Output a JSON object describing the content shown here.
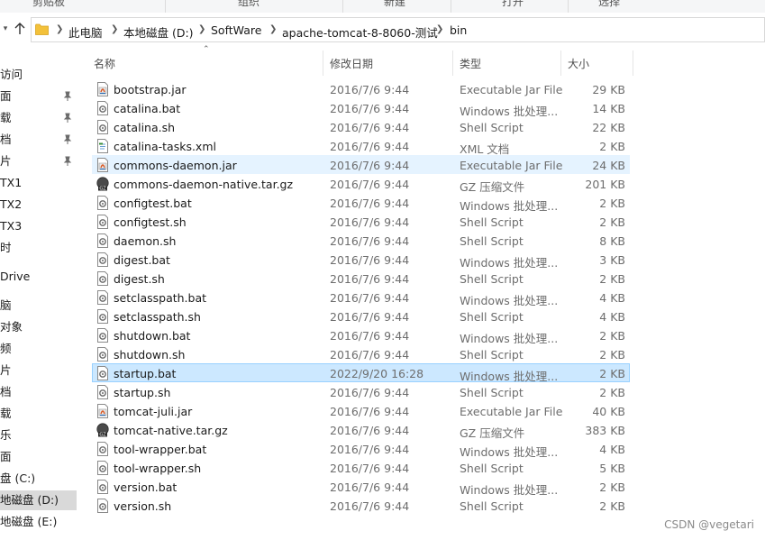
{
  "ribbon": {
    "groups": [
      "剪贴板",
      "组织",
      "新建",
      "打开",
      "选择"
    ]
  },
  "nav": {
    "back_icon": "arrow-left-icon",
    "forward_icon": "arrow-right-icon",
    "recent_icon": "chevron-down-icon",
    "up_icon": "arrow-up-icon"
  },
  "address": {
    "folder_icon": "folder-icon",
    "crumbs": [
      "此电脑",
      "本地磁盘 (D:)",
      "SoftWare",
      "apache-tomcat-8-8060-测试",
      "bin"
    ]
  },
  "navpane": {
    "items": [
      {
        "label": "访问",
        "pinned": false
      },
      {
        "label": "面",
        "pinned": true
      },
      {
        "label": "载",
        "pinned": true
      },
      {
        "label": "档",
        "pinned": true
      },
      {
        "label": "片",
        "pinned": true
      },
      {
        "label": "TX1",
        "pinned": false
      },
      {
        "label": "TX2",
        "pinned": false
      },
      {
        "label": "TX3",
        "pinned": false
      },
      {
        "label": "时",
        "pinned": false
      },
      {
        "label": "Drive",
        "pinned": false
      },
      {
        "label": "脑",
        "pinned": false
      },
      {
        "label": "对象",
        "pinned": false
      },
      {
        "label": "频",
        "pinned": false
      },
      {
        "label": "片",
        "pinned": false
      },
      {
        "label": "档",
        "pinned": false
      },
      {
        "label": "载",
        "pinned": false
      },
      {
        "label": "乐",
        "pinned": false
      },
      {
        "label": "面",
        "pinned": false
      },
      {
        "label": "盘 (C:)",
        "pinned": false
      },
      {
        "label": "地磁盘 (D:)",
        "pinned": false,
        "selected": true
      },
      {
        "label": "地磁盘 (E:)",
        "pinned": false
      }
    ]
  },
  "columns": {
    "name": "名称",
    "date": "修改日期",
    "type": "类型",
    "size": "大小"
  },
  "files": [
    {
      "name": "bootstrap.jar",
      "date": "2016/7/6 9:44",
      "type": "Executable Jar File",
      "size": "29 KB",
      "icon": "jar-file-icon"
    },
    {
      "name": "catalina.bat",
      "date": "2016/7/6 9:44",
      "type": "Windows 批处理...",
      "size": "14 KB",
      "icon": "batch-file-icon"
    },
    {
      "name": "catalina.sh",
      "date": "2016/7/6 9:44",
      "type": "Shell Script",
      "size": "22 KB",
      "icon": "script-file-icon"
    },
    {
      "name": "catalina-tasks.xml",
      "date": "2016/7/6 9:44",
      "type": "XML 文档",
      "size": "2 KB",
      "icon": "xml-file-icon"
    },
    {
      "name": "commons-daemon.jar",
      "date": "2016/7/6 9:44",
      "type": "Executable Jar File",
      "size": "24 KB",
      "icon": "jar-file-icon",
      "state": "hover"
    },
    {
      "name": "commons-daemon-native.tar.gz",
      "date": "2016/7/6 9:44",
      "type": "GZ 压缩文件",
      "size": "201 KB",
      "icon": "gz-archive-icon"
    },
    {
      "name": "configtest.bat",
      "date": "2016/7/6 9:44",
      "type": "Windows 批处理...",
      "size": "2 KB",
      "icon": "batch-file-icon"
    },
    {
      "name": "configtest.sh",
      "date": "2016/7/6 9:44",
      "type": "Shell Script",
      "size": "2 KB",
      "icon": "script-file-icon"
    },
    {
      "name": "daemon.sh",
      "date": "2016/7/6 9:44",
      "type": "Shell Script",
      "size": "8 KB",
      "icon": "script-file-icon"
    },
    {
      "name": "digest.bat",
      "date": "2016/7/6 9:44",
      "type": "Windows 批处理...",
      "size": "3 KB",
      "icon": "batch-file-icon"
    },
    {
      "name": "digest.sh",
      "date": "2016/7/6 9:44",
      "type": "Shell Script",
      "size": "2 KB",
      "icon": "script-file-icon"
    },
    {
      "name": "setclasspath.bat",
      "date": "2016/7/6 9:44",
      "type": "Windows 批处理...",
      "size": "4 KB",
      "icon": "batch-file-icon"
    },
    {
      "name": "setclasspath.sh",
      "date": "2016/7/6 9:44",
      "type": "Shell Script",
      "size": "4 KB",
      "icon": "script-file-icon"
    },
    {
      "name": "shutdown.bat",
      "date": "2016/7/6 9:44",
      "type": "Windows 批处理...",
      "size": "2 KB",
      "icon": "batch-file-icon"
    },
    {
      "name": "shutdown.sh",
      "date": "2016/7/6 9:44",
      "type": "Shell Script",
      "size": "2 KB",
      "icon": "script-file-icon"
    },
    {
      "name": "startup.bat",
      "date": "2022/9/20 16:28",
      "type": "Windows 批处理...",
      "size": "2 KB",
      "icon": "batch-file-icon",
      "state": "selected"
    },
    {
      "name": "startup.sh",
      "date": "2016/7/6 9:44",
      "type": "Shell Script",
      "size": "2 KB",
      "icon": "script-file-icon"
    },
    {
      "name": "tomcat-juli.jar",
      "date": "2016/7/6 9:44",
      "type": "Executable Jar File",
      "size": "40 KB",
      "icon": "jar-file-icon"
    },
    {
      "name": "tomcat-native.tar.gz",
      "date": "2016/7/6 9:44",
      "type": "GZ 压缩文件",
      "size": "383 KB",
      "icon": "gz-archive-icon"
    },
    {
      "name": "tool-wrapper.bat",
      "date": "2016/7/6 9:44",
      "type": "Windows 批处理...",
      "size": "4 KB",
      "icon": "batch-file-icon"
    },
    {
      "name": "tool-wrapper.sh",
      "date": "2016/7/6 9:44",
      "type": "Shell Script",
      "size": "5 KB",
      "icon": "script-file-icon"
    },
    {
      "name": "version.bat",
      "date": "2016/7/6 9:44",
      "type": "Windows 批处理...",
      "size": "2 KB",
      "icon": "batch-file-icon"
    },
    {
      "name": "version.sh",
      "date": "2016/7/6 9:44",
      "type": "Shell Script",
      "size": "2 KB",
      "icon": "script-file-icon"
    }
  ],
  "watermark": "CSDN @vegetari",
  "colors": {
    "hover_row": "#e5f3ff",
    "selected_row": "#cce8ff",
    "selected_border": "#99d1ff",
    "folder": "#f3c13a"
  }
}
